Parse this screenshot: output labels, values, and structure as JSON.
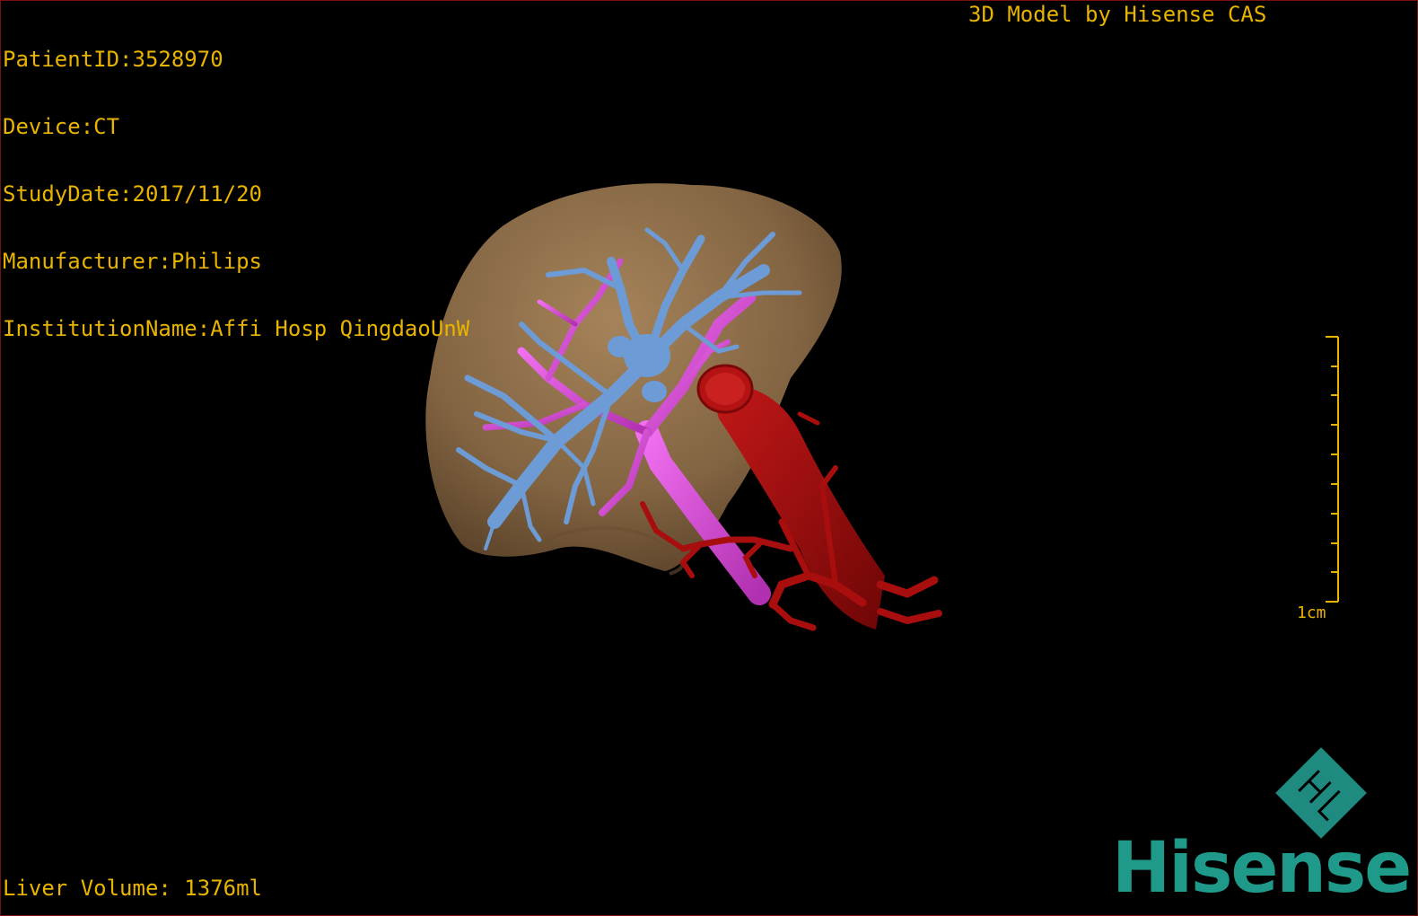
{
  "patient_info": {
    "patient_id": "PatientID:3528970",
    "device": "Device:CT",
    "study_date": "StudyDate:2017/11/20",
    "manufacturer": "Manufacturer:Philips",
    "institution": "InstitutionName:Affi Hosp QingdaoUnW"
  },
  "credit": "3D Model by Hisense CAS",
  "liver_volume": "Liver Volume: 1376ml",
  "scale_bar": {
    "label": "1cm"
  },
  "logo": {
    "text": "Hisense",
    "mark_letters": "H L"
  },
  "colors": {
    "overlay_text": "#e8b400",
    "liver": "#9c7b54",
    "hepatic_vein": "#6d9bd6",
    "portal_vein": "#d84ad8",
    "artery": "#a80e0e",
    "brand": "#1f9a8a"
  },
  "icons": {
    "logo_mark": "hisense-diamond-logo-icon"
  }
}
